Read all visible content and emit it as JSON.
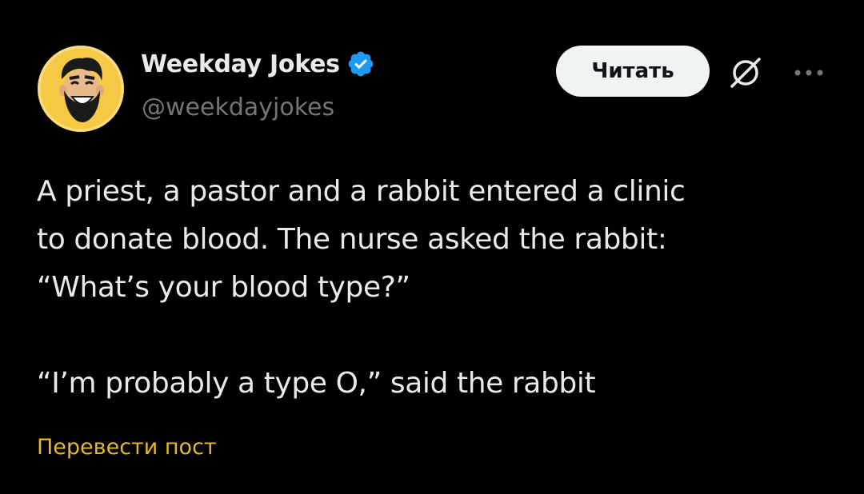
{
  "author": {
    "display_name": "Weekday Jokes",
    "handle": "@weekdayjokes",
    "verified": true,
    "avatar_icon": "bearded-man-laughing-avatar",
    "avatar_bg": "#f6c945"
  },
  "actions": {
    "follow_label": "Читать",
    "grok_icon": "slashed-circle-icon",
    "more_icon": "more-dots-icon"
  },
  "post": {
    "lines": [
      "A priest, a pastor and a rabbit entered a clinic",
      "to donate blood. The nurse asked the rabbit:",
      "“What’s your blood type?”",
      "“I’m probably a type O,” said the rabbit"
    ]
  },
  "translate_label": "Перевести пост",
  "colors": {
    "background": "#000000",
    "text_primary": "#e7e9ea",
    "text_secondary": "#71767b",
    "verified_badge": "#1d9bf0",
    "follow_button_bg": "#eff3f4",
    "translate_link": "#e3b92a"
  }
}
